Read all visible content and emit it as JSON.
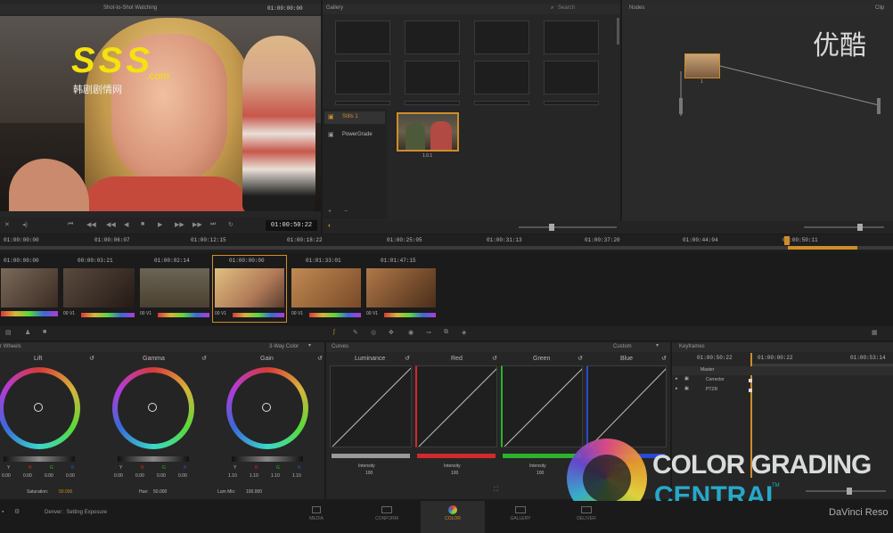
{
  "viewer": {
    "mode_label": "Shot-to-Shot Watching",
    "timecode_top": "01:00:00:00",
    "timecode": "01:00:50:22",
    "watermark_logo": "SSS",
    "watermark_com": ".com",
    "watermark_sub": "韩剧剧情网",
    "watermark_site": "优酷"
  },
  "gallery": {
    "title": "Gallery",
    "search_placeholder": "Search",
    "albums": [
      "Stills 1",
      "PowerGrade"
    ],
    "still_label": "1.0.1"
  },
  "nodes": {
    "title": "Nodes",
    "clip_label": "Clip",
    "node_label": "1"
  },
  "ruler": {
    "labels": [
      "01:00:00:00",
      "01:00:06:07",
      "01:00:12:15",
      "01:00:18:22",
      "01:00:25:05",
      "01:00:31:13",
      "01:00:37:20",
      "01:00:44:04",
      "01:00:50:11"
    ]
  },
  "clips": [
    {
      "tc": "01:00:00:00",
      "track": "00 V1"
    },
    {
      "tc": "00:00:03:21",
      "track": "00 V1"
    },
    {
      "tc": "01:00:02:14",
      "track": "00 V1"
    },
    {
      "tc": "01:00:00:00",
      "track": "00 V1"
    },
    {
      "tc": "01:01:33:01",
      "track": "00 V1"
    },
    {
      "tc": "01:01:47:15",
      "track": "00 V1"
    }
  ],
  "wheels": {
    "title": "r Wheels",
    "mode": "3-Way Color",
    "items": [
      {
        "label": "Lift",
        "vals": [
          "0.00",
          "0.00",
          "0.00",
          "0.00"
        ]
      },
      {
        "label": "Gamma",
        "vals": [
          "0.00",
          "0.00",
          "0.00",
          "0.00"
        ]
      },
      {
        "label": "Gain",
        "vals": [
          "1.10",
          "1.10",
          "1.10",
          "1.10"
        ]
      }
    ],
    "channel_letters": [
      "Y",
      "R",
      "G",
      "B"
    ],
    "saturation_label": "Saturation:",
    "saturation": "50.000",
    "hue_label": "Hue:",
    "hue": "50.000",
    "lum_mix_label": "Lum Mix:",
    "lum_mix": "100.000"
  },
  "curves": {
    "title": "Curves",
    "mode": "Custom",
    "channels": [
      "Luminance",
      "Red",
      "Green",
      "Blue"
    ],
    "intensity_label": "Intensity",
    "intensity_value": "100",
    "colors": {
      "luminance": "#9a9a9a",
      "red": "#d22a2a",
      "green": "#2ab52a",
      "blue": "#2a4ad2"
    }
  },
  "keyframes": {
    "title": "Keyframes",
    "timecodes": [
      "01:00:50:22",
      "01:00:00:22",
      "01:00:53:14"
    ],
    "tracks": [
      "Master",
      "Corrector",
      "PTZR"
    ]
  },
  "statusbar": {
    "project": "Denver : Setting Exposure",
    "pages": [
      "MEDIA",
      "CONFORM",
      "COLOR",
      "GALLERY",
      "DELIVER"
    ],
    "active_page": "COLOR",
    "brand": "DaVinci Reso"
  },
  "overlay": {
    "line1": "COLOR GRADING",
    "line2": "CENTRAL",
    "tm": "TM"
  }
}
